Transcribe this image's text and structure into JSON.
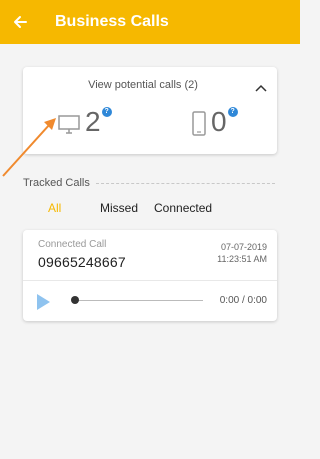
{
  "appbar": {
    "title": "Business Calls",
    "back_icon": "arrow-left-icon",
    "background": "#f6b800"
  },
  "potential_calls": {
    "title": "View potential calls (2)",
    "collapse_icon": "chevron-up-icon",
    "desktop": {
      "icon": "desktop-icon",
      "count": "2",
      "help": "?"
    },
    "mobile": {
      "icon": "mobile-icon",
      "count": "0",
      "help": "?"
    }
  },
  "tracked": {
    "label": "Tracked Calls",
    "tabs": [
      {
        "label": "All",
        "active": true
      },
      {
        "label": "Missed",
        "active": false
      },
      {
        "label": "Connected",
        "active": false
      }
    ]
  },
  "call": {
    "status": "Connected Call",
    "number": "09665248667",
    "date": "07-07-2019",
    "time": "11:23:51 AM",
    "duration": "0:00 / 0:00",
    "play_icon": "play-icon",
    "progress": 0
  },
  "colors": {
    "accent": "#f6b800",
    "help_badge": "#2f88d8",
    "play": "#8fc3ef",
    "arrow": "#f08a2e"
  }
}
